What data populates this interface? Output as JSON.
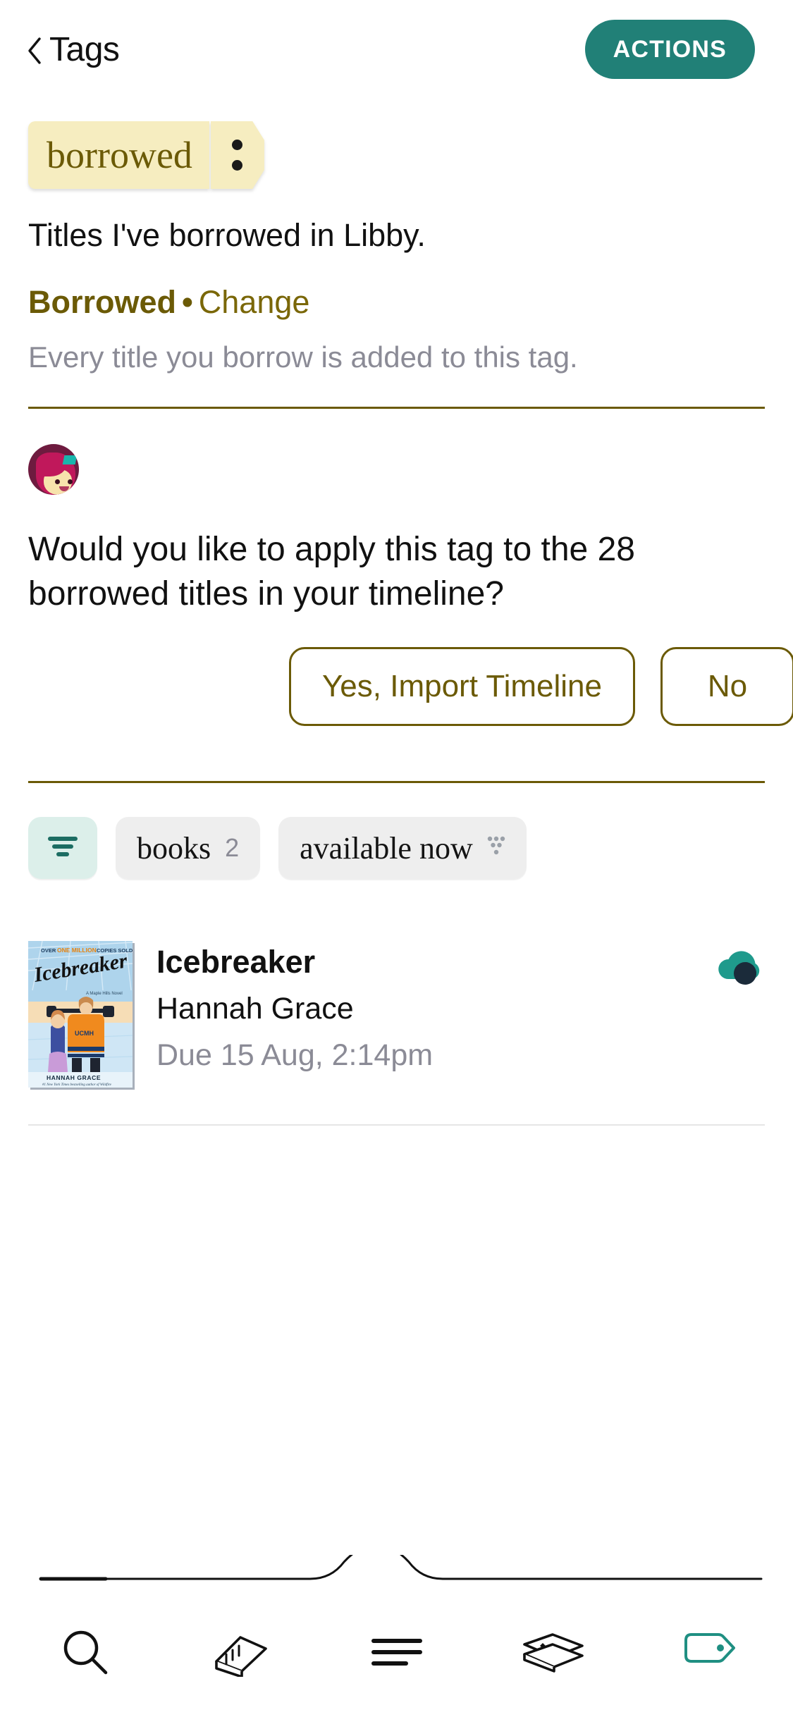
{
  "header": {
    "back_label": "Tags",
    "back_icon": "chevron-left-icon",
    "actions_label": "ACTIONS"
  },
  "tag": {
    "name": "borrowed",
    "overflow_icon": "two-dot-menu-icon",
    "description": "Titles I've borrowed in Libby.",
    "rule_label": "Borrowed",
    "rule_separator": "•",
    "rule_change_label": "Change",
    "rule_note": "Every title you borrow is added to this tag."
  },
  "prompt": {
    "avatar_icon": "libby-avatar-icon",
    "question": "Would you like to apply this tag to the 28 borrowed titles in your timeline?",
    "yes_label": "Yes, Import Timeline",
    "no_label": "No"
  },
  "filters": {
    "sort_icon": "sort-lines-icon",
    "chips": [
      {
        "label": "books",
        "count": "2",
        "icon": ""
      },
      {
        "label": "available now",
        "count": "",
        "icon": "availability-icon"
      }
    ]
  },
  "list": [
    {
      "title": "Icebreaker",
      "author": "Hannah Grace",
      "status": "Due 15 Aug, 2:14pm",
      "badge_icon": "cloud-downloaded-icon",
      "cover": {
        "banner": "OVER ONE MILLION COPIES SOLD!",
        "banner_highlight": "ONE MILLION",
        "title": "Icebreaker",
        "subtitle": "A Maple Hills Novel",
        "jersey": "UCMH",
        "author": "HANNAH GRACE",
        "author_note": "#1 New York Times bestselling author of Wildfire"
      }
    }
  ],
  "nav": {
    "items": [
      {
        "icon": "search-icon",
        "active": false
      },
      {
        "icon": "library-icon",
        "active": false
      },
      {
        "icon": "menu-lines-icon",
        "active": false
      },
      {
        "icon": "shelf-books-icon",
        "active": false
      },
      {
        "icon": "tag-icon",
        "active": true
      }
    ]
  },
  "colors": {
    "accent_teal": "#218077",
    "olive": "#6b5a06",
    "tag_yellow": "#f6edc0",
    "muted": "#8b8b96"
  }
}
